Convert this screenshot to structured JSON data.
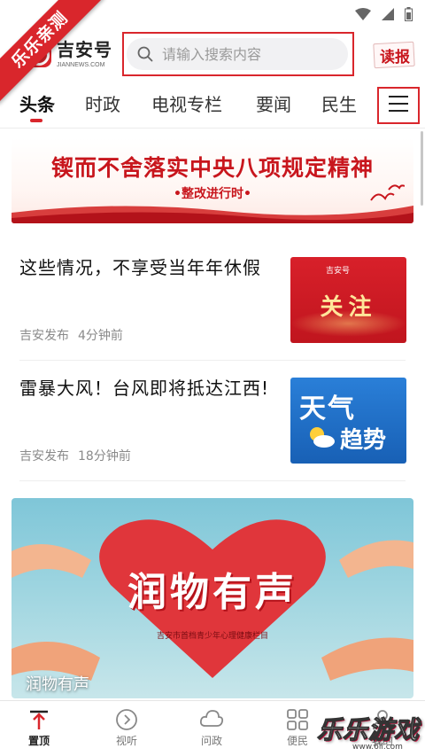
{
  "watermark": {
    "ribbon_text": "乐乐亲测",
    "corner_text": "乐乐游戏",
    "corner_url": "www.6ll.com"
  },
  "header": {
    "logo_name": "吉安号",
    "logo_sub": "JIANNEWS.COM",
    "search_placeholder": "请输入搜索内容",
    "read_label": "读报"
  },
  "tabs": [
    {
      "label": "头条",
      "active": true
    },
    {
      "label": "时政"
    },
    {
      "label": "电视专栏"
    },
    {
      "label": "要闻"
    },
    {
      "label": "民生"
    }
  ],
  "menu_icon": "hamburger-menu-icon",
  "banner": {
    "title": "锲而不舍落实中央八项规定精神",
    "subtitle": "•整改进行时•"
  },
  "news": [
    {
      "title": "这些情况，不享受当年年休假",
      "source": "吉安发布",
      "time": "4分钟前",
      "thumb": {
        "logo": "吉安号",
        "word": "关注"
      }
    },
    {
      "title": "雷暴大风！台风即将抵达江西!",
      "source": "吉安发布",
      "time": "18分钟前",
      "thumb": {
        "line1": "天气",
        "line2": "趋势"
      }
    }
  ],
  "feature": {
    "title": "润物有声",
    "subtitle": "吉安市首档青少年心理健康栏目",
    "caption": "润物有声"
  },
  "bottom_nav": [
    {
      "label": "置顶",
      "icon": "pin-top-icon",
      "active": true
    },
    {
      "label": "视听",
      "icon": "play-circle-icon"
    },
    {
      "label": "问政",
      "icon": "cloud-icon"
    },
    {
      "label": "便民",
      "icon": "grid-icon"
    },
    {
      "label": "我的",
      "icon": "user-icon"
    }
  ],
  "colors": {
    "brand_red": "#d9262c",
    "text_dark": "#111111",
    "meta_gray": "#8a8a8a"
  }
}
